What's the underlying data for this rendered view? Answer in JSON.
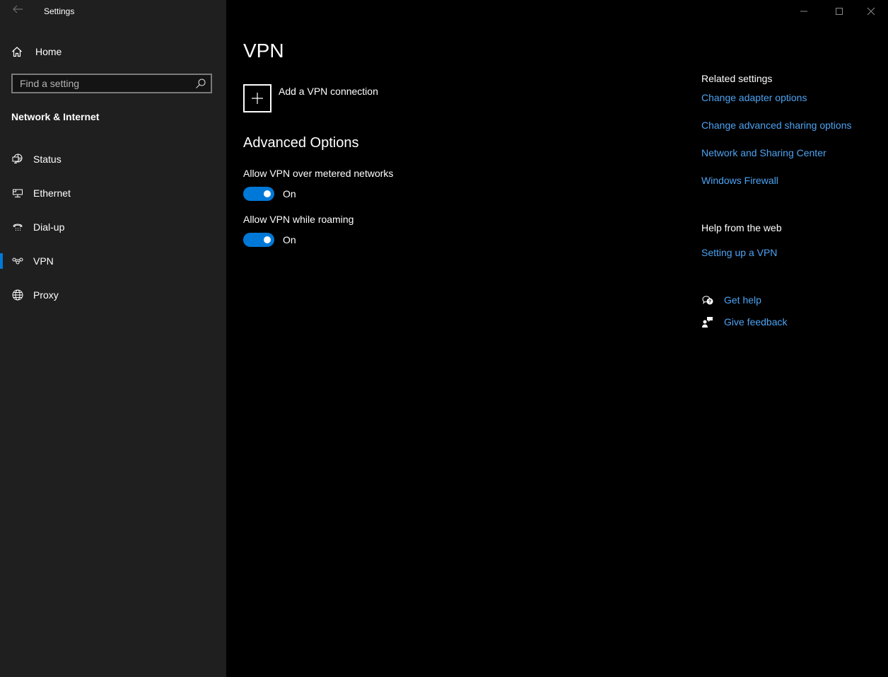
{
  "window": {
    "title": "Settings",
    "controls": {
      "minimize": "minimize-icon",
      "maximize": "maximize-icon",
      "close": "close-icon"
    }
  },
  "sidebar": {
    "back_icon": "back-arrow-icon",
    "home_label": "Home",
    "search": {
      "placeholder": "Find a setting",
      "value": ""
    },
    "section_title": "Network & Internet",
    "items": [
      {
        "label": "Status",
        "icon": "globe-monitor-icon",
        "active": false
      },
      {
        "label": "Ethernet",
        "icon": "ethernet-icon",
        "active": false
      },
      {
        "label": "Dial-up",
        "icon": "dialup-phone-icon",
        "active": false
      },
      {
        "label": "VPN",
        "icon": "vpn-icon",
        "active": true
      },
      {
        "label": "Proxy",
        "icon": "globe-icon",
        "active": false
      }
    ]
  },
  "main": {
    "title": "VPN",
    "add_vpn_label": "Add a VPN connection",
    "advanced_title": "Advanced Options",
    "options": [
      {
        "label": "Allow VPN over metered networks",
        "state": "On",
        "enabled": true
      },
      {
        "label": "Allow VPN while roaming",
        "state": "On",
        "enabled": true
      }
    ]
  },
  "related": {
    "heading": "Related settings",
    "links": [
      "Change adapter options",
      "Change advanced sharing options",
      "Network and Sharing Center",
      "Windows Firewall"
    ],
    "help_heading": "Help from the web",
    "help_links": [
      "Setting up a VPN"
    ],
    "get_help": "Get help",
    "give_feedback": "Give feedback"
  },
  "colors": {
    "accent": "#0078d7",
    "link": "#4ca3f2",
    "sidebar_bg": "#1f1f1f",
    "main_bg": "#000000"
  }
}
